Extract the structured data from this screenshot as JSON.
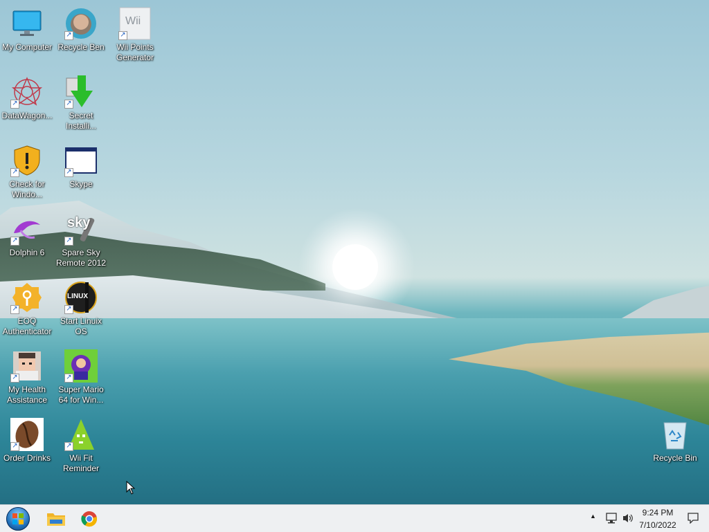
{
  "desktop": {
    "icons": [
      {
        "label": "My Computer"
      },
      {
        "label": "Recycle Ben"
      },
      {
        "label": "Wii Points\nGenerator"
      },
      {
        "label": "DataWagon..."
      },
      {
        "label": "Secret\nInstalli..."
      },
      {
        "label": "Check for\nWindo..."
      },
      {
        "label": "Skype"
      },
      {
        "label": "Dolphin 6"
      },
      {
        "label": "Spare Sky\nRemote 2012"
      },
      {
        "label": "EOQ\nAuthenticator"
      },
      {
        "label": "Start Linuix\nOS"
      },
      {
        "label": "My Health\nAssistance"
      },
      {
        "label": "Super Mario\n64 for Win..."
      },
      {
        "label": "Order Drinks"
      },
      {
        "label": "Wii Fit\nReminder"
      },
      {
        "label": "Recycle Bin"
      }
    ],
    "icon_badges": {
      "wii": "Wii",
      "sky": "sky",
      "linux": "LINUX"
    }
  },
  "taskbar": {
    "clock_time": "9:24 PM",
    "clock_date": "7/10/2022",
    "tray_arrow": "▲"
  },
  "colors": {
    "taskbar_bg": "#eef0f2",
    "accent_blue": "#1f6fb8"
  }
}
